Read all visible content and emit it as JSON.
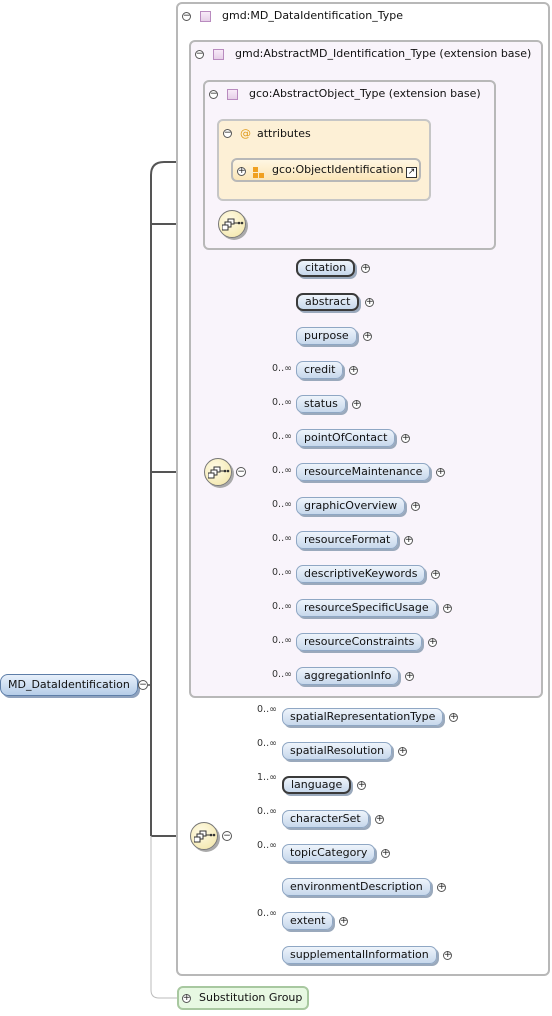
{
  "root": {
    "label": "MD_DataIdentification"
  },
  "type_frames": {
    "outer": "gmd:MD_DataIdentification_Type",
    "extension1": "gmd:AbstractMD_Identification_Type (extension base)",
    "extension2": "gco:AbstractObject_Type (extension base)"
  },
  "attributes": {
    "at_symbol": "@",
    "label": "attributes",
    "group": "gco:ObjectIdentification"
  },
  "sequence_1": {
    "elements": [
      {
        "label": "citation",
        "cardinality": ""
      },
      {
        "label": "abstract",
        "cardinality": ""
      },
      {
        "label": "purpose",
        "cardinality": ""
      },
      {
        "label": "credit",
        "cardinality": "0..∞"
      },
      {
        "label": "status",
        "cardinality": "0..∞"
      },
      {
        "label": "pointOfContact",
        "cardinality": "0..∞"
      },
      {
        "label": "resourceMaintenance",
        "cardinality": "0..∞"
      },
      {
        "label": "graphicOverview",
        "cardinality": "0..∞"
      },
      {
        "label": "resourceFormat",
        "cardinality": "0..∞"
      },
      {
        "label": "descriptiveKeywords",
        "cardinality": "0..∞"
      },
      {
        "label": "resourceSpecificUsage",
        "cardinality": "0..∞"
      },
      {
        "label": "resourceConstraints",
        "cardinality": "0..∞"
      },
      {
        "label": "aggregationInfo",
        "cardinality": "0..∞"
      }
    ]
  },
  "sequence_2": {
    "elements": [
      {
        "label": "spatialRepresentationType",
        "cardinality": "0..∞"
      },
      {
        "label": "spatialResolution",
        "cardinality": "0..∞"
      },
      {
        "label": "language",
        "cardinality": "1..∞"
      },
      {
        "label": "characterSet",
        "cardinality": "0..∞"
      },
      {
        "label": "topicCategory",
        "cardinality": "0..∞"
      },
      {
        "label": "environmentDescription",
        "cardinality": ""
      },
      {
        "label": "extent",
        "cardinality": "0..∞"
      },
      {
        "label": "supplementalInformation",
        "cardinality": ""
      }
    ]
  },
  "substitution_group": {
    "label": "Substitution Group"
  },
  "glyphs": {
    "collapse": "−",
    "expand": "+",
    "link": "↗"
  }
}
